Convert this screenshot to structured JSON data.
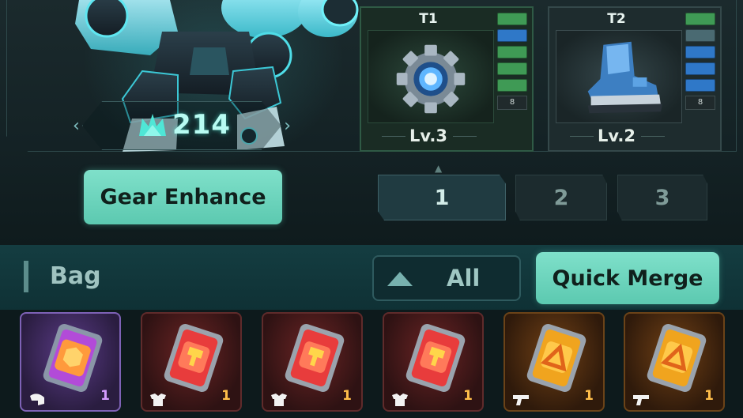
{
  "hero": {
    "power_value": "214",
    "power_icon": "crown-power-icon"
  },
  "slots": [
    {
      "tier": "T1",
      "level": "Lv.3",
      "item_icon": "gear-core-icon",
      "lock": "8",
      "pips": [
        "#3f9a55",
        "#2f78c8",
        "#3f9a55",
        "#3f9a55",
        "#3f9a55"
      ]
    },
    {
      "tier": "T2",
      "level": "Lv.2",
      "item_icon": "boot-icon",
      "lock": "8",
      "pips": [
        "#3f9a55",
        "#4a6a72",
        "#2f78c8",
        "#2f78c8",
        "#2f78c8"
      ]
    }
  ],
  "actions": {
    "enhance_label": "Gear Enhance",
    "quick_merge_label": "Quick Merge"
  },
  "pages": {
    "items": [
      "1",
      "2",
      "3"
    ],
    "active": "1"
  },
  "bag": {
    "title": "Bag",
    "filter_label": "All",
    "items": [
      {
        "rarity": "purple",
        "type_icon": "helmet-icon",
        "qty": "1"
      },
      {
        "rarity": "red",
        "type_icon": "armor-icon",
        "qty": "1"
      },
      {
        "rarity": "red",
        "type_icon": "armor-icon",
        "qty": "1"
      },
      {
        "rarity": "red",
        "type_icon": "armor-icon",
        "qty": "1"
      },
      {
        "rarity": "orange",
        "type_icon": "gun-icon",
        "qty": "1"
      },
      {
        "rarity": "orange",
        "type_icon": "gun-icon",
        "qty": "1"
      }
    ]
  },
  "colors": {
    "accent": "#6fd6bf",
    "panel": "#142225",
    "bag_header": "#123a3e",
    "rarity_purple": "#7e62b6",
    "rarity_red": "#c43a3a",
    "rarity_orange": "#e0961f"
  }
}
